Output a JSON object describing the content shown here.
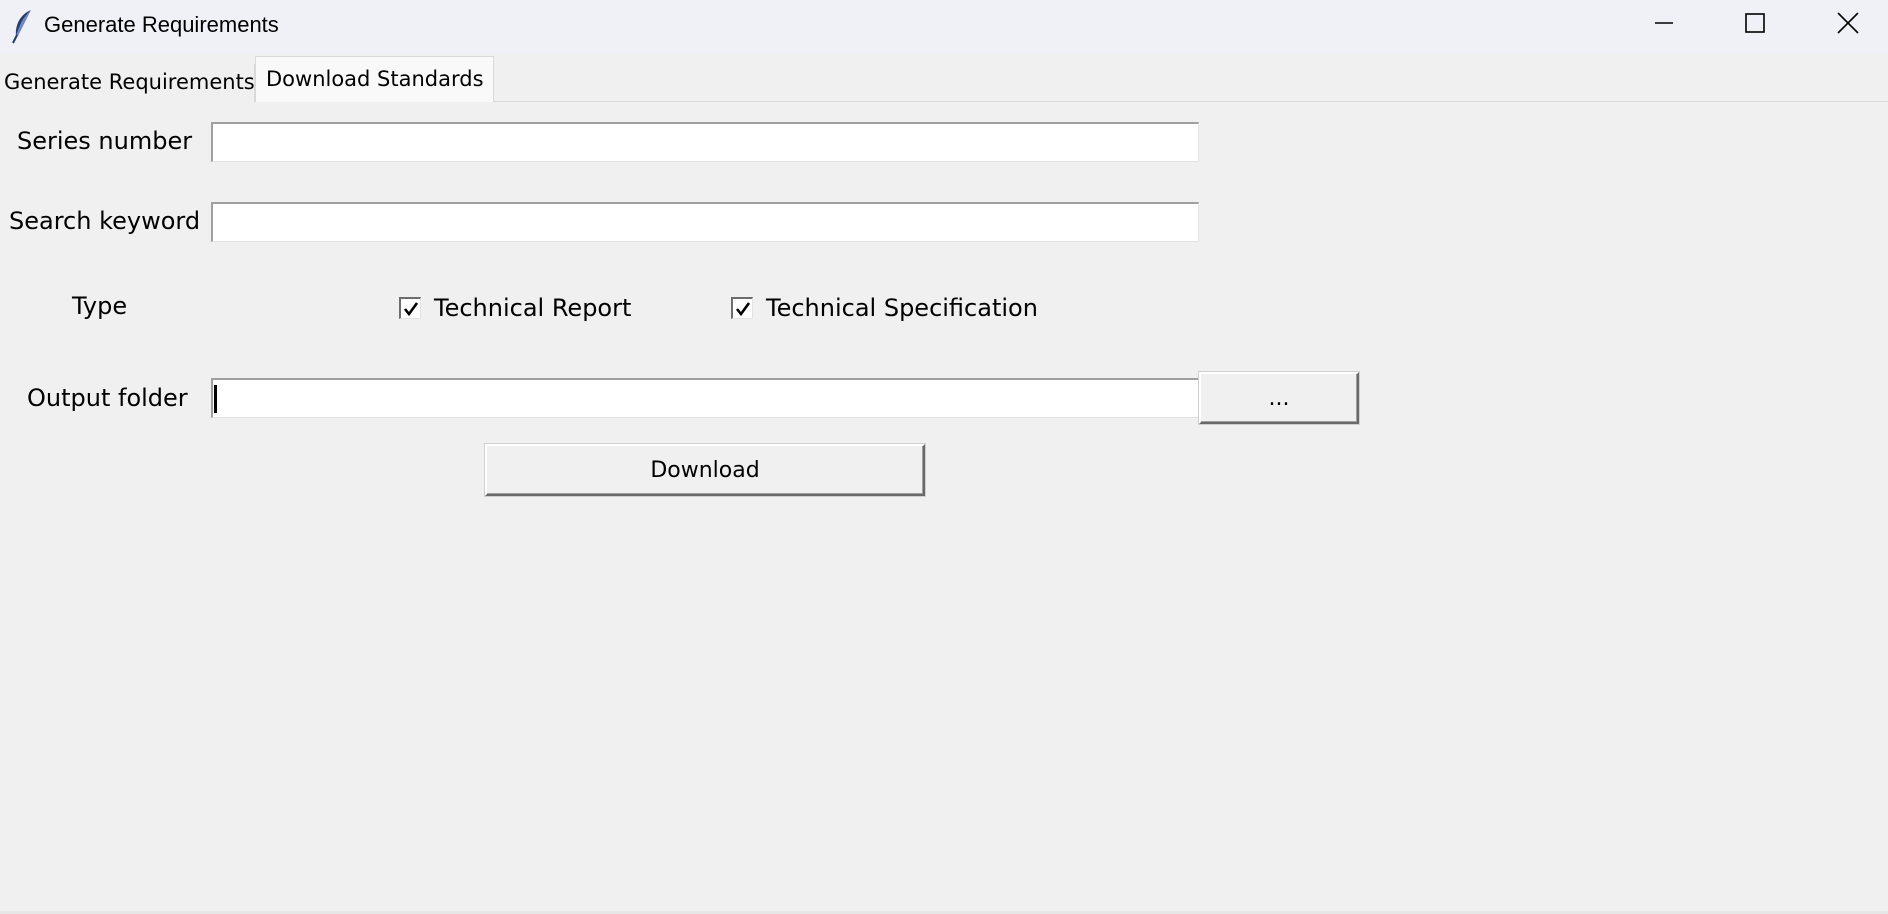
{
  "window": {
    "title": "Generate Requirements",
    "controls": {
      "minimize_icon": "minimize-icon",
      "maximize_icon": "maximize-icon",
      "close_icon": "close-icon"
    },
    "app_icon": "feather-icon"
  },
  "tabs": [
    {
      "label": "Generate Requirements",
      "active": false
    },
    {
      "label": "Download Standards",
      "active": true
    }
  ],
  "form": {
    "series": {
      "label": "Series number",
      "value": ""
    },
    "keyword": {
      "label": "Search keyword",
      "value": ""
    },
    "type": {
      "label": "Type",
      "options": [
        {
          "label": "Technical Report",
          "checked": true
        },
        {
          "label": "Technical Specification",
          "checked": true
        }
      ]
    },
    "output": {
      "label": "Output folder",
      "value": "",
      "browse_label": "..."
    },
    "download_label": "Download"
  },
  "colors": {
    "background": "#f0f0f0",
    "titlebar": "#eff1f6",
    "entry_bg": "#ffffff",
    "active_tab": "#f9f9f9"
  }
}
